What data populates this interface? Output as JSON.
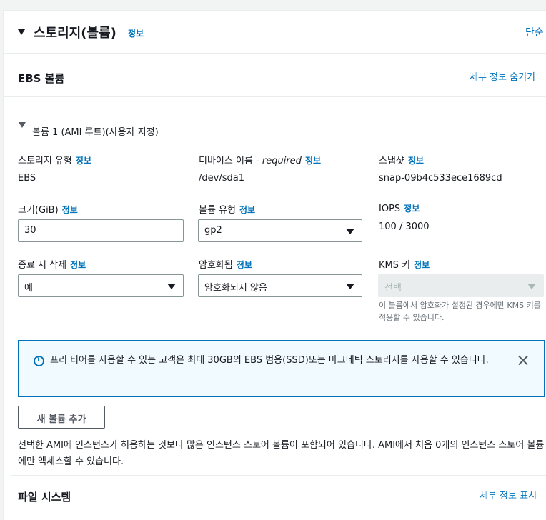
{
  "storage_section": {
    "title": "스토리지(볼륨)",
    "info": "정보",
    "simple_link": "단순"
  },
  "ebs": {
    "title": "EBS 볼륨",
    "hide_details": "세부 정보 숨기기"
  },
  "volume": {
    "title": "볼륨 1 (AMI 루트)(사용자 지정)",
    "storage_type_label": "스토리지 유형",
    "storage_type_value": "EBS",
    "device_name_label": "디바이스 이름 - ",
    "device_name_required": "required",
    "device_name_value": "/dev/sda1",
    "snapshot_label": "스냅샷",
    "snapshot_value": "snap-09b4c533ece1689cd",
    "size_label": "크기(GiB)",
    "size_value": "30",
    "volume_type_label": "볼륨 유형",
    "volume_type_value": "gp2",
    "iops_label": "IOPS",
    "iops_value": "100 / 3000",
    "delete_on_termination_label": "종료 시 삭제",
    "delete_on_termination_value": "예",
    "encrypted_label": "암호화됨",
    "encrypted_value": "암호화되지 않음",
    "kms_key_label": "KMS 키",
    "kms_key_placeholder": "선택",
    "kms_hint": "이 볼륨에서 암호화가 설정된 경우에만 KMS 키를 적용할 수 있습니다.",
    "info": "정보"
  },
  "alert": {
    "text": "프리 티어를 사용할 수 있는 고객은 최대 30GB의 EBS 범용(SSD)또는 마그네틱 스토리지를 사용할 수 있습니다."
  },
  "add_volume_button": "새 볼륨 추가",
  "instance_store_note": "선택한 AMI에 인스턴스가 허용하는 것보다 많은 인스턴스 스토어 볼륨이 포함되어 있습니다. AMI에서 처음 0개의 인스턴스 스토어 볼륨에만 액세스할 수 있습니다.",
  "file_system": {
    "title": "파일 시스템",
    "show_details": "세부 정보 표시"
  },
  "colors": {
    "link": "#0073bb",
    "text": "#16191f",
    "border": "#879596",
    "alert_bg": "#f1faff"
  },
  "icons": [
    "caret-down-icon",
    "info-circle-icon",
    "close-icon",
    "dropdown-arrow-icon"
  ]
}
